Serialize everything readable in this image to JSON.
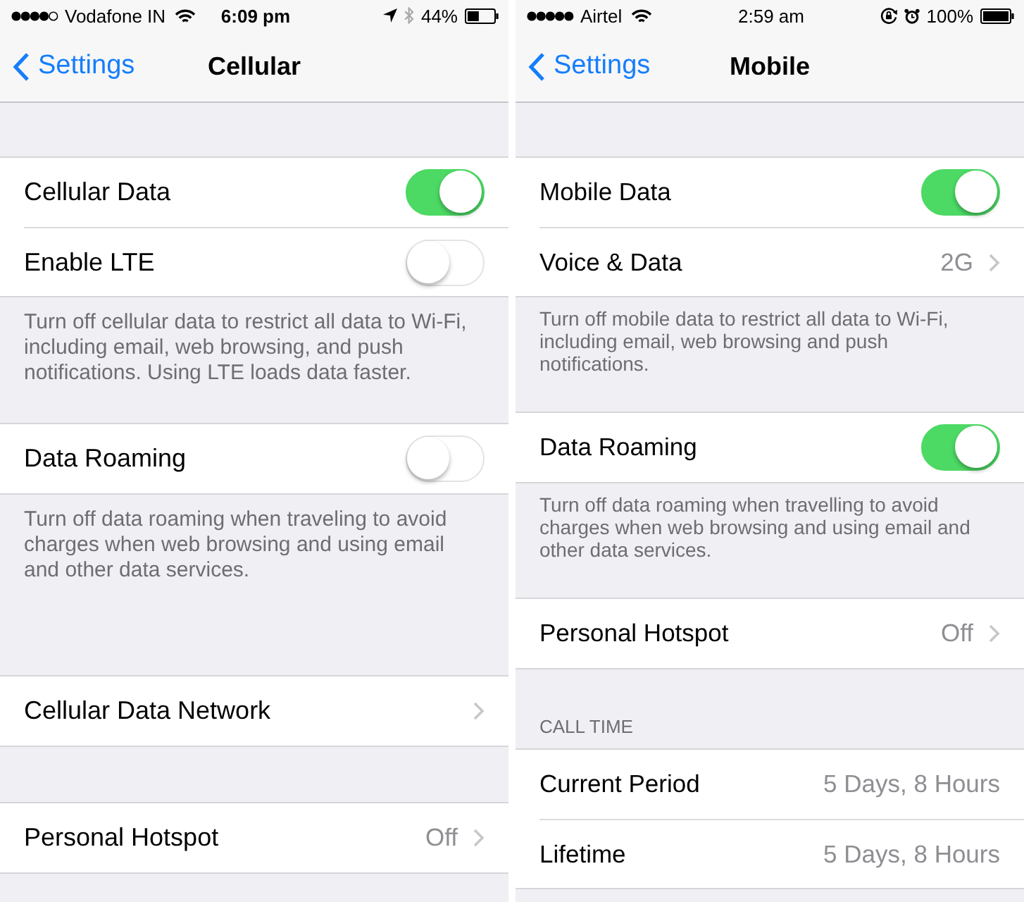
{
  "screens": [
    {
      "status_bar": {
        "signal_dots": [
          {
            "filled": true
          },
          {
            "filled": true
          },
          {
            "filled": true
          },
          {
            "filled": true
          },
          {
            "filled": false
          }
        ],
        "carrier": "Vodafone IN",
        "time": "6:09 pm",
        "indicators": [
          {
            "kind": "location"
          },
          {
            "kind": "bluetooth"
          }
        ],
        "battery": "44%"
      },
      "nav_bar": {
        "back": "Settings",
        "title": "Cellular"
      },
      "groups": [
        {
          "rows": [
            {
              "kind": "switch",
              "label": "Cellular Data",
              "on": true
            },
            {
              "kind": "switch",
              "label": "Enable LTE",
              "on": false
            }
          ],
          "footer": "Turn off cellular data to restrict all data to Wi-Fi, including email, web browsing, and push notifications. Using LTE loads data faster."
        },
        {
          "rows": [
            {
              "kind": "switch",
              "label": "Data Roaming",
              "on": false
            }
          ],
          "footer": "Turn off data roaming when traveling to avoid charges when web browsing and using email and other data services."
        },
        {
          "rows": [
            {
              "kind": "link",
              "label": "Cellular Data Network"
            }
          ]
        },
        {
          "rows": [
            {
              "kind": "link",
              "label": "Personal Hotspot",
              "value": "Off"
            }
          ]
        }
      ]
    },
    {
      "status_bar": {
        "signal_dots": [
          {
            "filled": true
          },
          {
            "filled": true
          },
          {
            "filled": true
          },
          {
            "filled": true
          },
          {
            "filled": true
          }
        ],
        "carrier": "Airtel",
        "time": "2:59 am",
        "indicators": [
          {
            "kind": "rotation_lock"
          },
          {
            "kind": "alarm"
          }
        ],
        "battery": "100%"
      },
      "nav_bar": {
        "back": "Settings",
        "title": "Mobile"
      },
      "groups": [
        {
          "rows": [
            {
              "kind": "switch",
              "label": "Mobile Data",
              "on": true
            },
            {
              "kind": "link",
              "label": "Voice & Data",
              "value": "2G"
            }
          ],
          "footer": "Turn off mobile data to restrict all data to Wi-Fi, including email, web browsing and push notifications."
        },
        {
          "rows": [
            {
              "kind": "switch",
              "label": "Data Roaming",
              "on": true
            }
          ],
          "footer": "Turn off data roaming when travelling to avoid charges when web browsing and using email and other data services."
        },
        {
          "rows": [
            {
              "kind": "link",
              "label": "Personal Hotspot",
              "value": "Off"
            }
          ]
        },
        {
          "header": "CALL TIME",
          "rows": [
            {
              "kind": "value",
              "label": "Current Period",
              "value": "5 Days, 8 Hours"
            },
            {
              "kind": "value",
              "label": "Lifetime",
              "value": "5 Days, 8 Hours"
            }
          ]
        }
      ]
    }
  ]
}
